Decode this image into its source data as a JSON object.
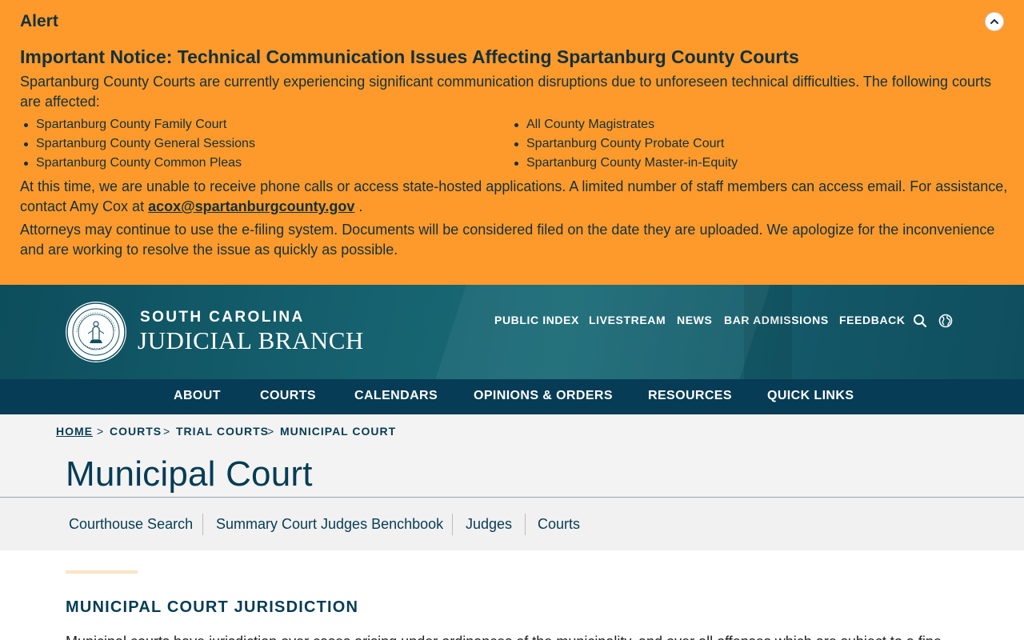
{
  "alert": {
    "label": "Alert",
    "heading": "Important Notice: Technical Communication Issues Affecting Spartanburg County Courts",
    "paragraph1": "Spartanburg County Courts are currently experiencing significant communication disruptions due to unforeseen technical difficulties. The following courts are affected:",
    "courts_left": [
      "Spartanburg County Family Court",
      "Spartanburg County General Sessions",
      "Spartanburg County Common Pleas"
    ],
    "courts_right": [
      "All County Magistrates",
      "Spartanburg County Probate Court",
      "Spartanburg County Master-in-Equity"
    ],
    "paragraph2_before": "At this time, we are unable to receive phone calls or access state-hosted applications. A limited number of staff members can access email. For assistance, contact Amy Cox at ",
    "contact_email": "acox@spartanburgcounty.gov",
    "paragraph2_after": " .",
    "paragraph3": "Attorneys may continue to use the e-filing system. Documents will be considered filed on the date they are uploaded. We apologize for the inconvenience and are working to resolve the issue as quickly as possible.",
    "toggle_icon": "chevron-up-icon"
  },
  "header": {
    "seal_text_outer": "SUPREME COURT OF SOUTH CAROLINA",
    "seal_text_inner": "NIL ULTRA",
    "brand_top": "SOUTH CAROLINA",
    "brand_bottom": "JUDICIAL BRANCH",
    "utility_links": [
      "PUBLIC INDEX",
      "LIVESTREAM",
      "NEWS",
      "BAR ADMISSIONS",
      "FEEDBACK"
    ],
    "search_icon": "search-icon",
    "language_icon": "globe-icon"
  },
  "main_nav": [
    "ABOUT",
    "COURTS",
    "CALENDARS",
    "OPINIONS & ORDERS",
    "RESOURCES",
    "QUICK LINKS"
  ],
  "breadcrumb": {
    "items": [
      "HOME",
      "COURTS",
      "TRIAL COURTS",
      "MUNICIPAL COURT"
    ],
    "separator": ">"
  },
  "page_title": "Municipal Court",
  "sub_nav": [
    "Courthouse Search",
    "Summary Court Judges Benchbook",
    "Judges",
    "Courts"
  ],
  "content": {
    "section_heading": "MUNICIPAL COURT JURISDICTION",
    "body_text": "Municipal courts have jurisdiction over cases arising under ordinances of the municipality, and over all offenses which are subject to a fine"
  },
  "colors": {
    "alert_bg": "#fd9a2b",
    "header_bg": "#16616f",
    "nav_bg": "#063c55",
    "title_bg": "#f3f3f3",
    "text_dark": "#063c55"
  }
}
